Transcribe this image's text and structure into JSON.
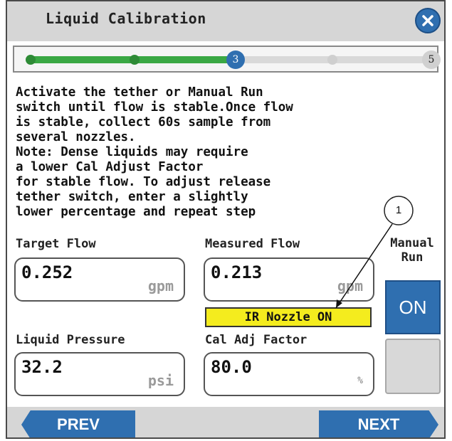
{
  "header": {
    "title": "Liquid Calibration",
    "close_icon": "close-icon"
  },
  "progress": {
    "current_step": "3",
    "last_step": "5",
    "completed_color": "#3aa844",
    "accent": "#2f6fb0"
  },
  "instructions": "Activate the tether or Manual Run\nswitch until flow is stable.Once flow\nis stable, collect 60s sample from\nseveral nozzles.\nNote: Dense liquids may require\na lower Cal Adjust Factor\nfor stable flow. To adjust release\ntether switch, enter a slightly\nlower percentage and repeat step",
  "fields": {
    "target_flow": {
      "label": "Target Flow",
      "value": "0.252",
      "unit": "gpm"
    },
    "measured_flow": {
      "label": "Measured Flow",
      "value": "0.213",
      "unit": "gpm"
    },
    "liquid_pressure": {
      "label": "Liquid Pressure",
      "value": "32.2",
      "unit": "psi"
    },
    "cal_adj_factor": {
      "label": "Cal Adj Factor",
      "value": "80.0",
      "unit": "%"
    }
  },
  "status_badge": {
    "text": "IR Nozzle ON",
    "color": "#f4ec1e"
  },
  "manual_run": {
    "label_line1": "Manual",
    "label_line2": "Run",
    "on_label": "ON"
  },
  "footer": {
    "prev_label": "PREV",
    "next_label": "NEXT"
  },
  "callout": {
    "number": "1"
  }
}
